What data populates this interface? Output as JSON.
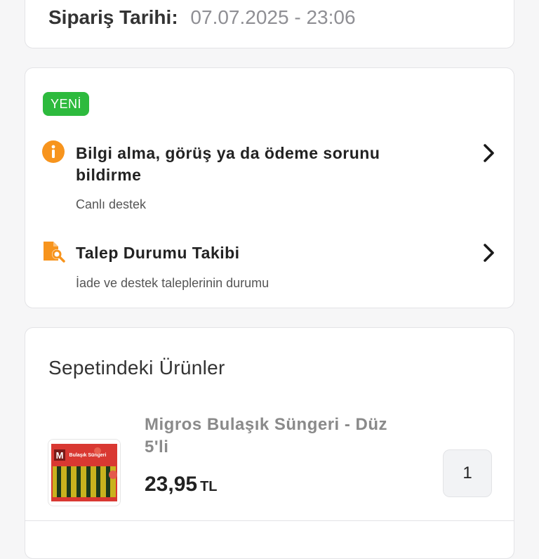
{
  "order": {
    "date_label": "Sipariş Tarihi:",
    "date_value": "07.07.2025 - 23:06"
  },
  "support": {
    "badge": "YENİ",
    "items": [
      {
        "icon": "info-icon",
        "title": "Bilgi alma, görüş ya da ödeme sorunu bildirme",
        "subtitle": "Canlı destek"
      },
      {
        "icon": "document-search-icon",
        "title": "Talep Durumu Takibi",
        "subtitle": "İade ve destek taleplerinin durumu"
      }
    ]
  },
  "products": {
    "title": "Sepetindeki Ürünler",
    "items": [
      {
        "image_brand": "M",
        "image_label": "Bulaşık Süngeri",
        "name": "Migros Bulaşık Süngeri - Düz 5'li",
        "price": "23,95",
        "currency": "TL",
        "quantity": "1"
      }
    ]
  },
  "colors": {
    "accent_orange": "#f7941d",
    "badge_green": "#2dba3d"
  }
}
